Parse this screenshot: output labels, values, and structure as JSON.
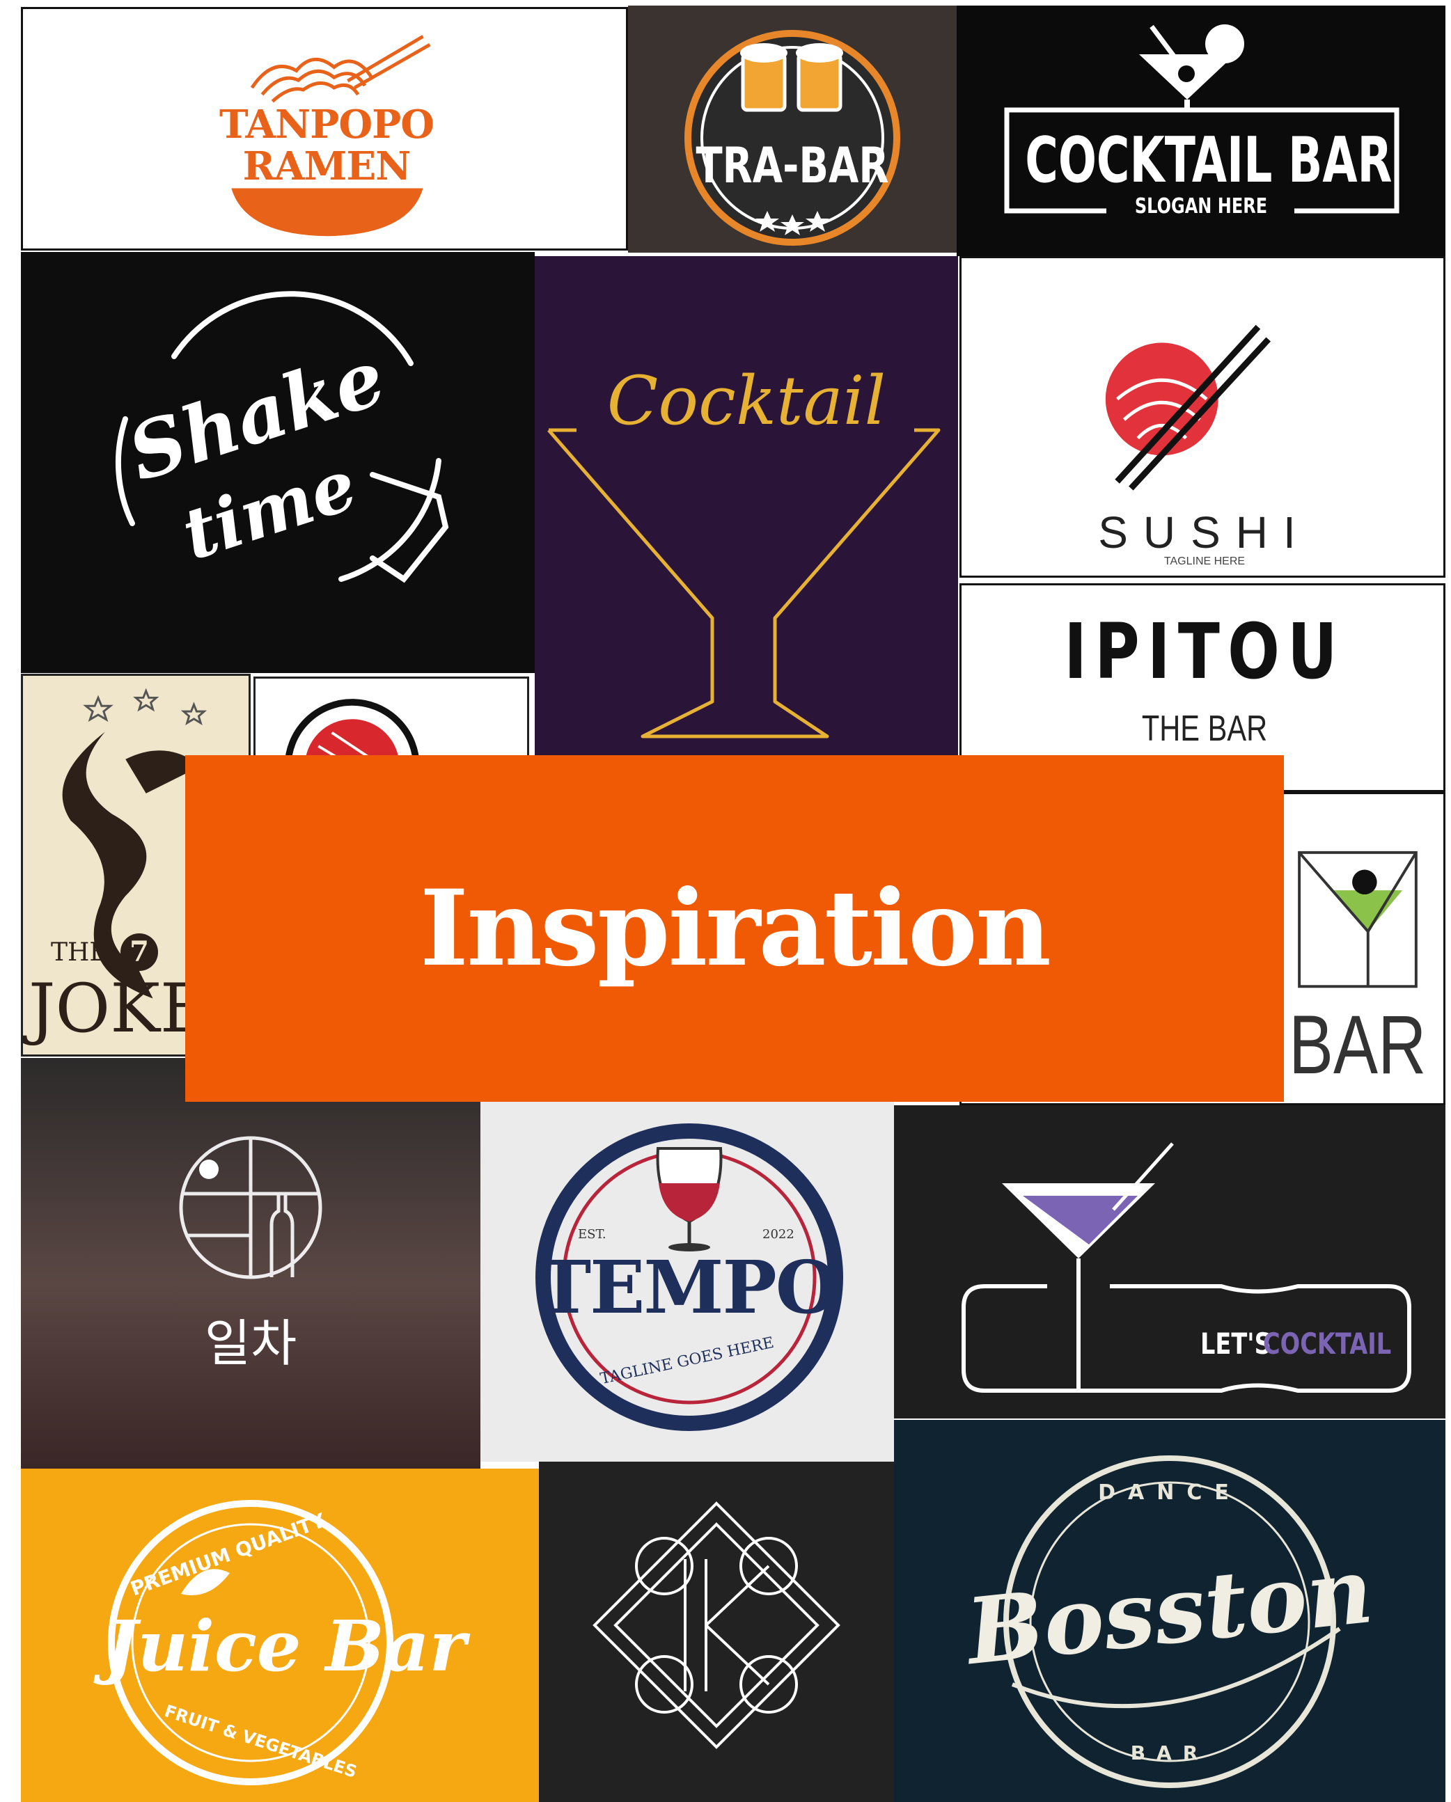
{
  "banner": {
    "title": "Inspiration"
  },
  "logos": {
    "tanpopo": {
      "line1": "TANPOPO",
      "line2": "RAMEN"
    },
    "trabar": {
      "name": "TRA-BAR"
    },
    "cocktail_bar": {
      "name": "COCKTAIL BAR",
      "slogan": "SLOGAN HERE"
    },
    "shake_time": {
      "line1": "Shake",
      "line2": "time"
    },
    "neon_cocktail": {
      "word": "Cocktail"
    },
    "sushi": {
      "name": "SUSHI",
      "tagline": "TAGLINE HERE"
    },
    "ipitou": {
      "name": "IPITOU",
      "sub": "THE BAR"
    },
    "joker": {
      "the": "THE",
      "number": "7",
      "name": "JOKE"
    },
    "mini_bar": {
      "text": "BAR"
    },
    "ilcha": {
      "name": "일차"
    },
    "tempo": {
      "name": "TEMPO",
      "est": "EST.",
      "year": "2022",
      "tagline": "TAGLINE GOES HERE"
    },
    "lets_cocktail": {
      "lets": "LET'S",
      "cocktail": "COCKTAIL"
    },
    "juice_bar": {
      "top": "PREMIUM QUALITY",
      "name": "Juice Bar",
      "bottom": "FRUIT & VEGETABLES"
    },
    "k_mark": {
      "letter": "K"
    },
    "bosston": {
      "top": "DANCE",
      "name": "Bosston",
      "bottom": "BAR"
    }
  },
  "colors": {
    "banner": "#f15a05",
    "ramen_orange": "#e8621a",
    "neon_gold": "#e7b233",
    "sushi_red": "#e2323b",
    "tempo_navy": "#1f2f5b",
    "tempo_red": "#b8243a",
    "lets_purple": "#7c64b4",
    "juice_yellow": "#f6a813",
    "bosston_navy": "#102330"
  }
}
